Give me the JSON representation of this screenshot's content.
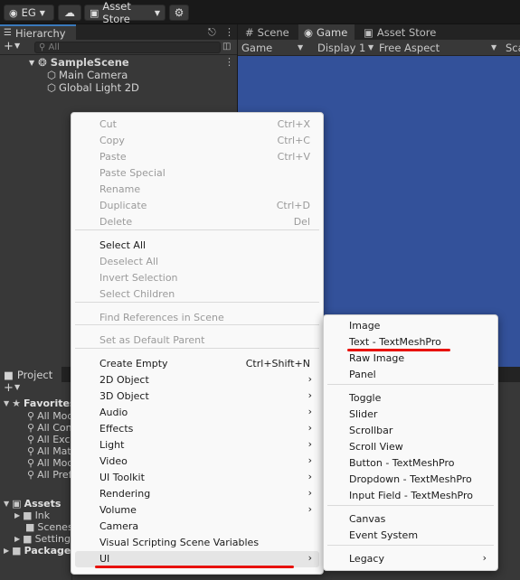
{
  "toolbar": {
    "account": "EG",
    "asset_store": "Asset Store"
  },
  "hierarchy": {
    "tab": "Hierarchy",
    "search_placeholder": "All",
    "scene": "SampleScene",
    "children": [
      "Main Camera",
      "Global Light 2D"
    ]
  },
  "game": {
    "tabs": [
      "Scene",
      "Game",
      "Asset Store"
    ],
    "view_select": "Game",
    "display": "Display 1",
    "aspect": "Free Aspect",
    "scale_cut": "Sca",
    "background_color": "#33519a"
  },
  "project": {
    "tab": "Project",
    "favorites_label": "Favorites",
    "favorites": [
      "All Mod",
      "All Conf",
      "All Excl",
      "All Mate",
      "All Mod",
      "All Pref"
    ],
    "assets_label": "Assets",
    "assets_children": [
      "Ink",
      "Scenes",
      "Setting"
    ],
    "packages_label": "Packages"
  },
  "context_menu": {
    "items": [
      {
        "label": "Cut",
        "shortcut": "Ctrl+X",
        "disabled": true
      },
      {
        "label": "Copy",
        "shortcut": "Ctrl+C",
        "disabled": true
      },
      {
        "label": "Paste",
        "shortcut": "Ctrl+V",
        "disabled": true
      },
      {
        "label": "Paste Special",
        "shortcut": "",
        "disabled": true
      },
      {
        "label": "Rename",
        "shortcut": "",
        "disabled": true
      },
      {
        "label": "Duplicate",
        "shortcut": "Ctrl+D",
        "disabled": true
      },
      {
        "label": "Delete",
        "shortcut": "Del",
        "disabled": true
      },
      {
        "label": "Select All",
        "shortcut": "",
        "disabled": false
      },
      {
        "label": "Deselect All",
        "shortcut": "",
        "disabled": true
      },
      {
        "label": "Invert Selection",
        "shortcut": "",
        "disabled": true
      },
      {
        "label": "Select Children",
        "shortcut": "",
        "disabled": true
      },
      {
        "label": "Find References in Scene",
        "shortcut": "",
        "disabled": true
      },
      {
        "label": "Set as Default Parent",
        "shortcut": "",
        "disabled": true
      },
      {
        "label": "Create Empty",
        "shortcut": "Ctrl+Shift+N",
        "disabled": false
      },
      {
        "label": "2D Object",
        "submenu": true
      },
      {
        "label": "3D Object",
        "submenu": true
      },
      {
        "label": "Audio",
        "submenu": true
      },
      {
        "label": "Effects",
        "submenu": true
      },
      {
        "label": "Light",
        "submenu": true
      },
      {
        "label": "Video",
        "submenu": true
      },
      {
        "label": "UI Toolkit",
        "submenu": true
      },
      {
        "label": "Rendering",
        "submenu": true
      },
      {
        "label": "Volume",
        "submenu": true
      },
      {
        "label": "Camera",
        "submenu": false
      },
      {
        "label": "Visual Scripting Scene Variables",
        "submenu": false
      },
      {
        "label": "UI",
        "submenu": true,
        "highlighted": true
      }
    ]
  },
  "ui_submenu": {
    "items": [
      "Image",
      "Text - TextMeshPro",
      "Raw Image",
      "Panel",
      "Toggle",
      "Slider",
      "Scrollbar",
      "Scroll View",
      "Button - TextMeshPro",
      "Dropdown - TextMeshPro",
      "Input Field - TextMeshPro",
      "Canvas",
      "Event System",
      "Legacy"
    ],
    "legacy_arrow": "›",
    "annotation_color": "#e8120c"
  }
}
